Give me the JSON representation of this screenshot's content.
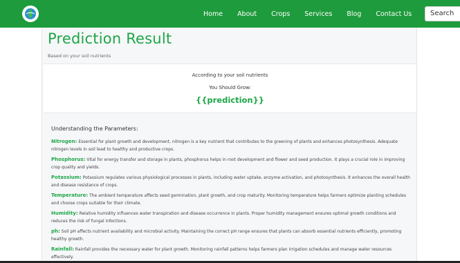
{
  "nav": {
    "links": [
      "Home",
      "About",
      "Crops",
      "Services",
      "Blog",
      "Contact Us"
    ],
    "search_placeholder": "Search",
    "logo_icon": "leaf-globe-icon"
  },
  "result": {
    "title": "Prediction Result",
    "subtitle": "Based on your soil nutrients",
    "line1": "According to your soil nutrients",
    "line2": "You Should Grow:",
    "prediction": "{{prediction}}"
  },
  "params": {
    "heading": "Understanding the Parameters:",
    "items": [
      {
        "name": "Nitrogen:",
        "text": "Essential for plant growth and development, nitrogen is a key nutrient that contributes to the greening of plants and enhances photosynthesis. Adequate nitrogen levels in soil lead to healthy and productive crops."
      },
      {
        "name": "Phosphorus:",
        "text": "Vital for energy transfer and storage in plants, phosphorus helps in root development and flower and seed production. It plays a crucial role in improving crop quality and yields."
      },
      {
        "name": "Potassium:",
        "text": "Potassium regulates various physiological processes in plants, including water uptake, enzyme activation, and photosynthesis. It enhances the overall health and disease resistance of crops."
      },
      {
        "name": "Temperature:",
        "text": "The ambient temperature affects seed germination, plant growth, and crop maturity. Monitoring temperature helps farmers optimize planting schedules and choose crops suitable for their climate."
      },
      {
        "name": "Humidity:",
        "text": "Relative humidity influences water transpiration and disease occurrence in plants. Proper humidity management ensures optimal growth conditions and reduces the risk of fungal infections."
      },
      {
        "name": "ph:",
        "text": "Soil pH affects nutrient availability and microbial activity. Maintaining the correct pH range ensures that plants can absorb essential nutrients efficiently, promoting healthy growth."
      },
      {
        "name": "Rainfall:",
        "text": "Rainfall provides the necessary water for plant growth. Monitoring rainfall patterns helps farmers plan irrigation schedules and manage water resources effectively."
      }
    ]
  },
  "colors": {
    "brand_green": "#1e9b3c",
    "accent_green": "#1ea647"
  }
}
